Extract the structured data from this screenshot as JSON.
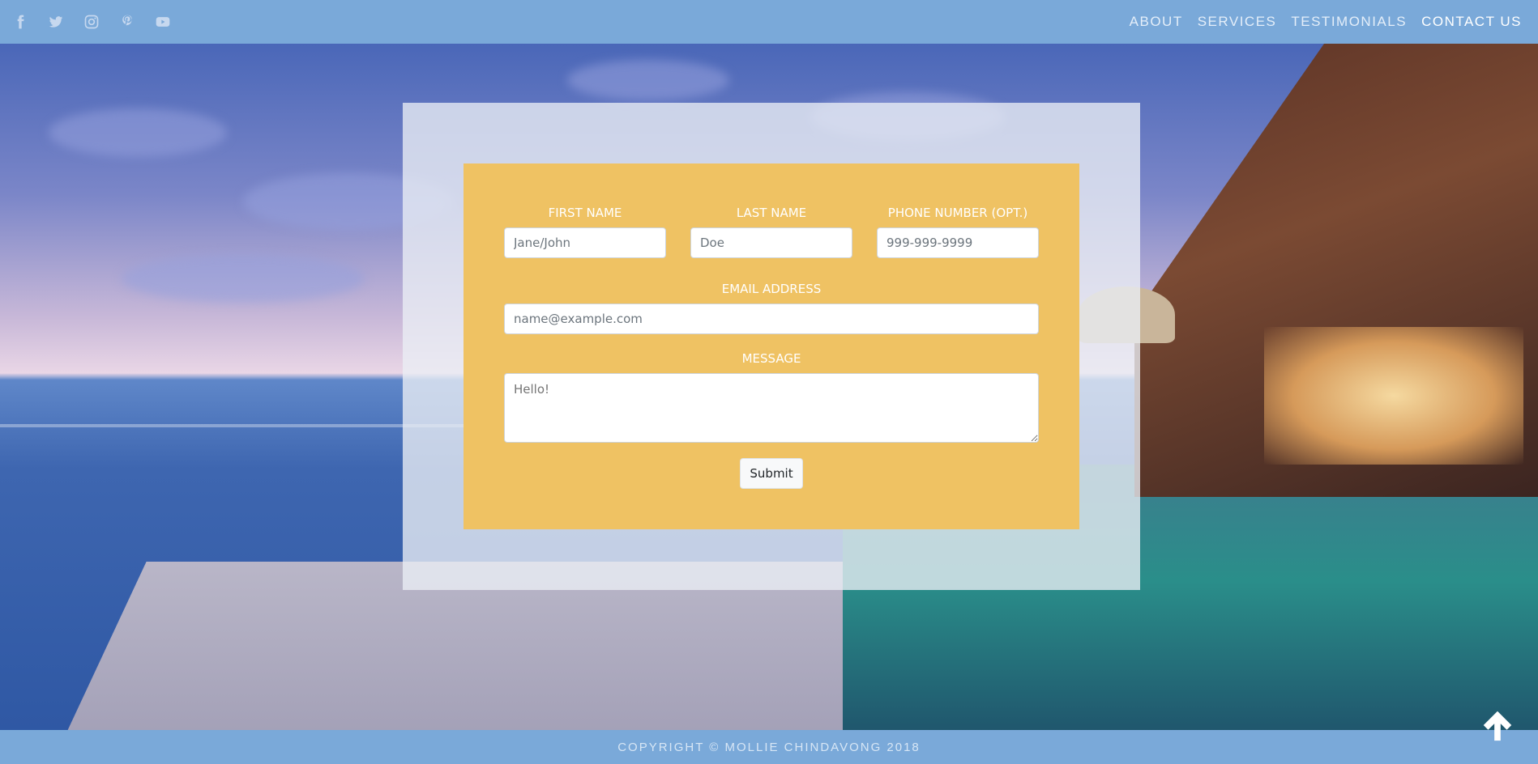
{
  "social": {
    "icons": [
      "facebook-icon",
      "twitter-icon",
      "instagram-icon",
      "pinterest-icon",
      "youtube-icon"
    ]
  },
  "nav": {
    "about": "ABOUT",
    "services": "SERVICES",
    "testimonials": "TESTIMONIALS",
    "contact": "CONTACT US"
  },
  "form": {
    "first_name_label": "FIRST NAME",
    "first_name_placeholder": "Jane/John",
    "last_name_label": "LAST NAME",
    "last_name_placeholder": "Doe",
    "phone_label": "PHONE NUMBER (OPT.)",
    "phone_placeholder": "999-999-9999",
    "email_label": "EMAIL ADDRESS",
    "email_placeholder": "name@example.com",
    "message_label": "MESSAGE",
    "message_placeholder": "Hello!",
    "submit_label": "Submit"
  },
  "footer": {
    "copyright": "COPYRIGHT © MOLLIE CHINDAVONG 2018"
  },
  "colors": {
    "topbar": "#7aa9d9",
    "form_bg": "#efc263",
    "overlay": "#ebeef5"
  }
}
